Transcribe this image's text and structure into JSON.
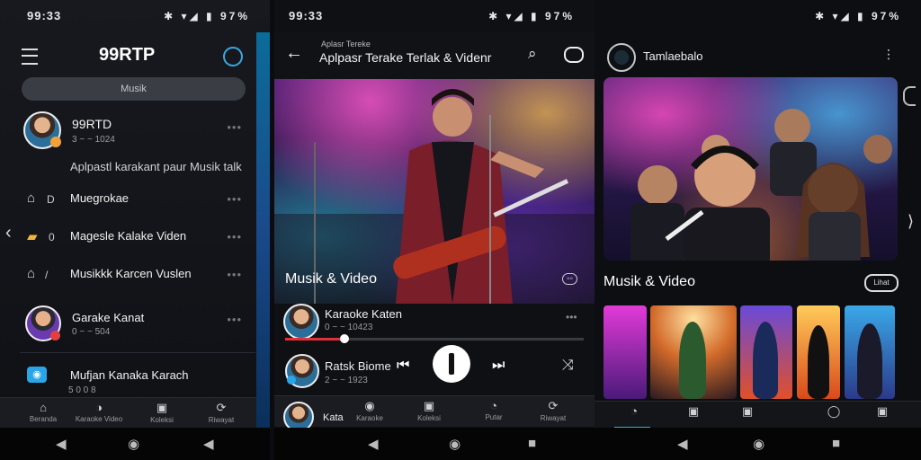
{
  "screen1": {
    "status_time": "99:33",
    "status_icons": "✱ ▾◢ ▮ 97%",
    "brand": "99RTP",
    "search_label": "Musik",
    "items": [
      {
        "title": "99RTD",
        "sub": "3 ~ ~ 1024",
        "type": "avatar"
      },
      {
        "title": "Aplpastl karakant paur Musik talk",
        "sub": "",
        "type": "text"
      },
      {
        "title": "Muegrokae",
        "sub": "",
        "type": "icon",
        "icon": "⌂",
        "badge": "D"
      },
      {
        "title": "Magesle Kalake Viden",
        "sub": "",
        "type": "icon",
        "icon": "▰",
        "badge": "0"
      },
      {
        "title": "Musikkk Karcen Vuslen",
        "sub": "",
        "type": "icon",
        "icon": "⌂",
        "badge": "/"
      },
      {
        "title": "Garake Kanat",
        "sub": "0 ~ ~ 504",
        "type": "avatar"
      },
      {
        "title": "Mufjan Kanaka Karach",
        "sub": "5 0 0 8",
        "type": "icon",
        "icon": "◉",
        "badge": ""
      }
    ],
    "tabs": [
      {
        "icon": "⌂",
        "label": "Beranda"
      },
      {
        "icon": "◑",
        "label": "Karaoke Video"
      },
      {
        "icon": "▣",
        "label": "Koleksi"
      },
      {
        "icon": "⟳",
        "label": "Riwayat"
      }
    ]
  },
  "screen2": {
    "status_time": "99:33",
    "status_icons": "✱ ▾◢ ▮ 97%",
    "title_small": "Aplasr Tereke",
    "title": "Aplpasr Terake Terlak & Videnr",
    "section": "Musik & Video",
    "track_title": "Karaoke Katen",
    "track_sub": "0 ~ ~ 10423",
    "progress": 0.2,
    "now_title": "Ratsk Biome",
    "now_sub": "2 ~ ~ 1923",
    "mini_title": "Kata",
    "tabs": [
      {
        "icon": "◉",
        "label": "Karaoke"
      },
      {
        "icon": "▣",
        "label": "Koleksi"
      },
      {
        "icon": "◔",
        "label": "Putar"
      },
      {
        "icon": "⟳",
        "label": "Riwayat"
      }
    ]
  },
  "screen3": {
    "status_time": "",
    "status_icons": "✱ ▾◢ ▮ 97%",
    "profile_name": "Tamlaebalo",
    "section": "Musik & Video",
    "more_label": "Lihat",
    "tabs": [
      {
        "icon": "◔",
        "label": ""
      },
      {
        "icon": "▣",
        "label": ""
      },
      {
        "icon": "▣",
        "label": ""
      },
      {
        "icon": "◯",
        "label": ""
      },
      {
        "icon": "▣",
        "label": ""
      }
    ]
  },
  "colors": {
    "accent": "#38a9e0",
    "progress": "#e0303a"
  }
}
